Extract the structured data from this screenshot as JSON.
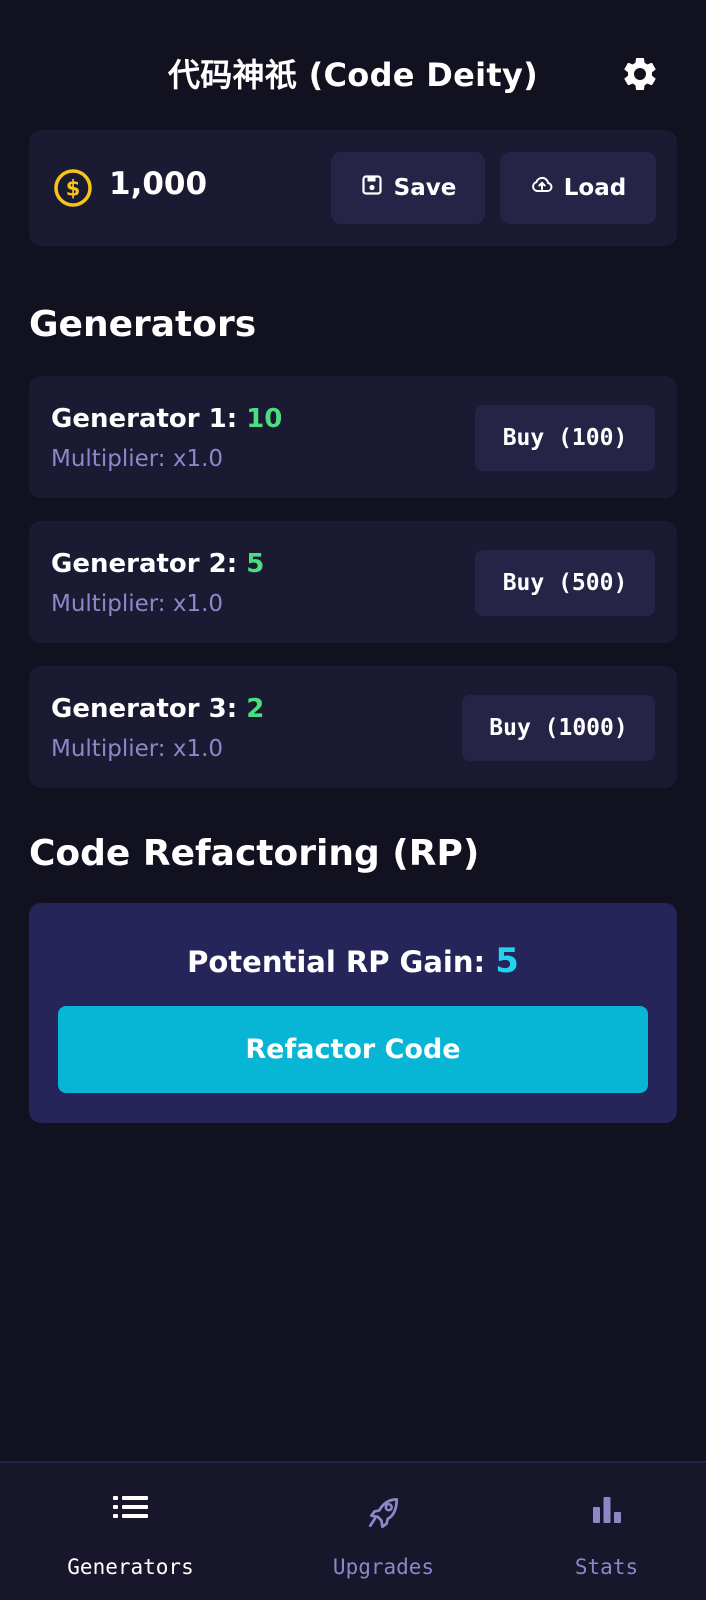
{
  "header": {
    "title": "代码神祇 (Code Deity)",
    "settings_icon": "gear-icon"
  },
  "wallet": {
    "coin_icon": "dollar-coin-icon",
    "amount": "1,000",
    "save_label": "Save",
    "load_label": "Load"
  },
  "generators_section": {
    "title": "Generators",
    "items": [
      {
        "label": "Generator 1: ",
        "count": "10",
        "multiplier": "Multiplier: x1.0",
        "buy_label": "Buy (100)"
      },
      {
        "label": "Generator 2: ",
        "count": "5",
        "multiplier": "Multiplier: x1.0",
        "buy_label": "Buy (500)"
      },
      {
        "label": "Generator 3: ",
        "count": "2",
        "multiplier": "Multiplier: x1.0",
        "buy_label": "Buy (1000)"
      }
    ]
  },
  "refactor_section": {
    "title": "Code Refactoring (RP)",
    "rp_label": "Potential RP Gain: ",
    "rp_value": "5",
    "button_label": "Refactor Code"
  },
  "nav": {
    "items": [
      {
        "label": "Generators",
        "icon": "list-icon",
        "active": true
      },
      {
        "label": "Upgrades",
        "icon": "rocket-icon",
        "active": false
      },
      {
        "label": "Stats",
        "icon": "bar-chart-icon",
        "active": false
      }
    ]
  },
  "colors": {
    "background": "#12111f",
    "card": "#1b1a33",
    "button": "#252447",
    "accent_cyan": "#06b6d4",
    "count_green": "#4ade80",
    "muted_text": "#8b88c9",
    "coin_gold": "#f5c518"
  }
}
